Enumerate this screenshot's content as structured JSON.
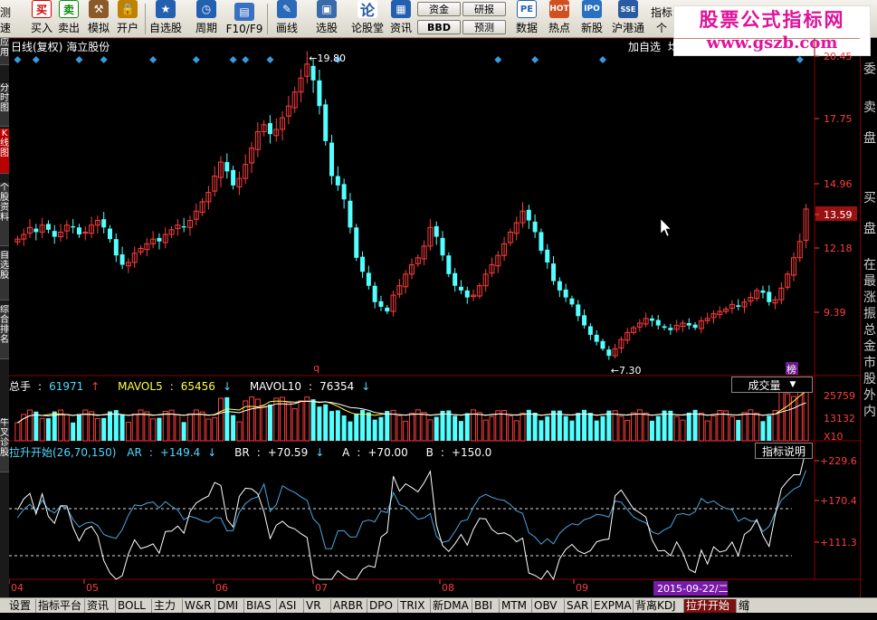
{
  "toolbar": {
    "items": [
      {
        "label": "测速",
        "color": "#888"
      },
      {
        "label": "买入",
        "color": "#d40000"
      },
      {
        "label": "卖出",
        "color": "#108a10"
      },
      {
        "label": "模拟",
        "color": "#8a5a2a"
      },
      {
        "label": "开户",
        "color": "#c08000"
      },
      {
        "label": "自选股",
        "color": "#2460b0"
      },
      {
        "label": "周期",
        "color": "#2460b0"
      },
      {
        "label": "F10/F9",
        "color": "#3a70c0"
      },
      {
        "label": "画线",
        "color": "#2a6ab8"
      },
      {
        "label": "选股",
        "color": "#3a6aaa"
      },
      {
        "label": "论股堂",
        "color": "#2a5aa0"
      },
      {
        "label": "资讯",
        "color": "#2460b0"
      },
      {
        "label": "数据",
        "color": "#2460b0"
      },
      {
        "label": "热点",
        "color": "#d05020"
      },
      {
        "label": "新股",
        "color": "#2a70c0"
      },
      {
        "label": "沪港通",
        "color": "#2a5aa0"
      },
      {
        "label": "指标",
        "color": "#555"
      },
      {
        "label": "个"
      }
    ],
    "pills": {
      "zijin": "资金",
      "bbd": "BBD",
      "yanbao": "研报",
      "yuce": "预测"
    }
  },
  "watermark": {
    "line1": "股票公式指标网",
    "line2": "www.gszb.com"
  },
  "chart": {
    "period": "日线(复权)",
    "stock_name": "海立股份",
    "add_favorite": "加自选",
    "add_favorite_suffix": "均"
  },
  "chart_data": {
    "type": "candlestick",
    "price_axis": {
      "labels": [
        "20.45",
        "17.75",
        "14.96",
        "13.59",
        "12.18",
        "9.39"
      ],
      "current_price": "13.59",
      "ylim": [
        6.8,
        20.45
      ]
    },
    "high_label": "19.80",
    "low_label": "7.30",
    "x_ticks": [
      "04",
      "05",
      "06",
      "07",
      "08",
      "09"
    ],
    "cursor_date": "2015-09-22/二",
    "prices": [
      12.3,
      12.5,
      12.8,
      12.6,
      12.9,
      12.7,
      12.4,
      12.6,
      12.9,
      12.8,
      12.5,
      12.6,
      12.9,
      13.1,
      12.8,
      12.3,
      11.6,
      11.2,
      11.3,
      11.7,
      11.9,
      12.1,
      12.3,
      12.2,
      12.5,
      12.7,
      12.9,
      12.8,
      13.1,
      13.5,
      13.9,
      14.3,
      15.0,
      15.6,
      15.2,
      14.6,
      14.9,
      15.5,
      16.2,
      16.9,
      17.2,
      16.8,
      17.0,
      17.5,
      18.0,
      18.6,
      19.2,
      19.8,
      19.1,
      18.0,
      16.5,
      15.0,
      14.6,
      14.0,
      12.8,
      11.5,
      10.9,
      10.3,
      9.6,
      9.4,
      9.2,
      9.9,
      10.3,
      10.8,
      11.2,
      11.5,
      12.0,
      12.8,
      12.4,
      11.6,
      10.8,
      10.3,
      10.1,
      9.8,
      9.9,
      10.3,
      10.8,
      11.2,
      11.6,
      12.1,
      12.6,
      13.0,
      13.5,
      13.1,
      12.6,
      11.8,
      11.3,
      10.5,
      10.1,
      9.8,
      9.5,
      9.0,
      8.6,
      8.2,
      7.9,
      7.6,
      7.3,
      7.6,
      8.0,
      8.3,
      8.5,
      8.7,
      8.9,
      8.8,
      8.6,
      8.5,
      8.4,
      8.6,
      8.7,
      8.6,
      8.5,
      8.8,
      8.9,
      9.1,
      9.2,
      9.3,
      9.5,
      9.4,
      9.6,
      9.8,
      10.1,
      10.0,
      9.6,
      9.7,
      10.2,
      10.8,
      11.5,
      12.2,
      13.59
    ],
    "volume": {
      "label": "总手",
      "value": "61971",
      "ma5_label": "MAVOL5",
      "ma5_value": "65456",
      "ma10_label": "MAVOL10",
      "ma10_value": "76354",
      "axis_labels": [
        "25759",
        "13132",
        "X10"
      ],
      "button": "成交量"
    },
    "indicator": {
      "name": "拉升开始(26,70,150)",
      "ar_label": "AR",
      "ar_value": "+149.4",
      "br_label": "BR",
      "br_value": "+70.59",
      "a_label": "A",
      "a_value": "+70.00",
      "b_label": "B",
      "b_value": "+150.0",
      "axis_labels": [
        "+229.6",
        "+170.4",
        "+111.3"
      ],
      "button": "指标说明"
    }
  },
  "left_tabs": [
    "应用",
    "分时图",
    "K线图",
    "个股资料",
    "自选股",
    "综合排名",
    "牛叉诊股"
  ],
  "right_panel": [
    "委",
    "卖",
    "盘",
    "买",
    "盘",
    "在",
    "最",
    "涨",
    "振",
    "总",
    "金",
    "市",
    "股",
    "外",
    "内"
  ],
  "markers": {
    "q": "q",
    "bang": "榜"
  },
  "bottom_tabs": [
    "设置",
    "指标平台",
    "资讯",
    "BOLL",
    "主力",
    "W&R",
    "DMI",
    "BIAS",
    "ASI",
    "VR",
    "ARBR",
    "DPO",
    "TRIX",
    "新DMA",
    "BBI",
    "MTM",
    "OBV",
    "SAR",
    "EXPMA",
    "背离KDJ",
    "拉升开始",
    "缩"
  ],
  "active_bottom_tab": "拉升开始"
}
